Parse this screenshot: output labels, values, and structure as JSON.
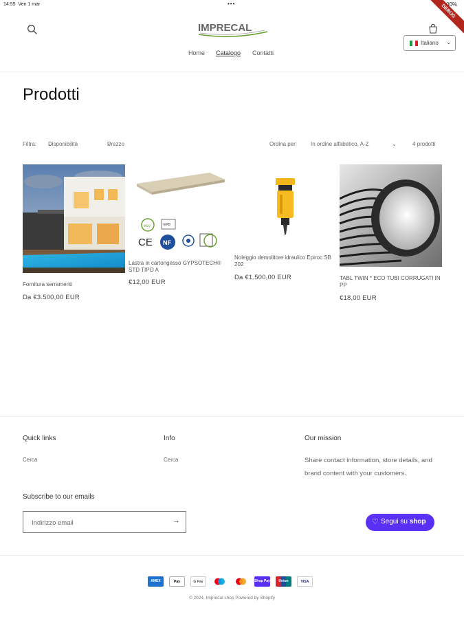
{
  "status_bar": {
    "time": "14:55",
    "date": "Ven 1 mar",
    "center": "•••",
    "right": "⊕ 100%",
    "debug_ribbon": "DEBUG"
  },
  "header": {
    "logo_text": "IMPRECAL",
    "nav": [
      "Home",
      "Catalogo",
      "Contatti"
    ],
    "language": "Italiano"
  },
  "page_title": "Prodotti",
  "filters": {
    "label": "Filtra:",
    "availability": "Disponibilità",
    "price": "Prezzo",
    "sort_label": "Ordina per:",
    "sort_value": "In ordine alfabetico, A-Z",
    "count": "4 prodotti"
  },
  "products": [
    {
      "title": "Fornitura serramenti",
      "price": "Da €3.500,00 EUR"
    },
    {
      "title": "Lastra in cartongesso GYPSOTECH® STD TIPO A",
      "price": "€12,00 EUR"
    },
    {
      "title": "Noleggio demolitore idraulico Epiroc SB 202",
      "price": "Da €1.500,00 EUR"
    },
    {
      "title": "TABL TWIN * ECO TUBI CORRUGATI IN PP",
      "price": "€18,00 EUR"
    }
  ],
  "footer": {
    "quick_links_heading": "Quick links",
    "quick_links": [
      "Cerca"
    ],
    "info_heading": "Info",
    "info_links": [
      "Cerca"
    ],
    "mission_heading": "Our mission",
    "mission_text": "Share contact information, store details, and brand content with your customers.",
    "subscribe_heading": "Subscribe to our emails",
    "email_placeholder": "Indirizzo email",
    "follow_label": "Segui su",
    "follow_brand": "shop",
    "payment_methods": [
      "AMEX",
      "Pay",
      "G Pay",
      "Maestro",
      "Mastercard",
      "Shop Pay",
      "Union Pay",
      "VISA"
    ],
    "copyright": "© 2024, Imprecal shop Powered by Shopify"
  },
  "colors": {
    "accent": "#5a31f4",
    "logo_green": "#6aa032",
    "logo_gray": "#666666"
  }
}
